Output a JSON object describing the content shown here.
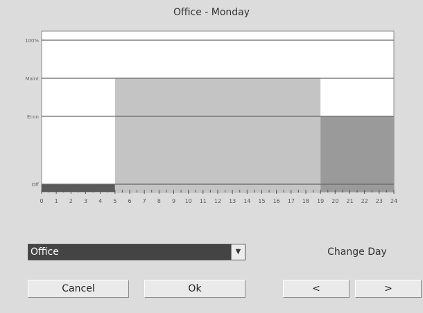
{
  "window": {
    "title": "Office - Monday"
  },
  "chart_data": {
    "type": "area",
    "title": "Office - Monday",
    "y_tick_labels": [
      "100%",
      "Maint",
      "Econ",
      "Off"
    ],
    "x": [
      0,
      1,
      2,
      3,
      4,
      5,
      6,
      7,
      8,
      9,
      10,
      11,
      12,
      13,
      14,
      15,
      16,
      17,
      18,
      19,
      20,
      21,
      22,
      23,
      24
    ],
    "x_tick_labels": [
      "0",
      "1",
      "2",
      "3",
      "4",
      "5",
      "6",
      "7",
      "8",
      "9",
      "10",
      "11",
      "12",
      "13",
      "14",
      "15",
      "16",
      "17",
      "18",
      "19",
      "20",
      "21",
      "22",
      "23",
      "24"
    ],
    "xlim": [
      0,
      24
    ],
    "segments": [
      {
        "start": 0,
        "end": 5,
        "level": "Off"
      },
      {
        "start": 5,
        "end": 19,
        "level": "Maint"
      },
      {
        "start": 19,
        "end": 24,
        "level": "Econ"
      }
    ],
    "grid": true,
    "colors": {
      "Off": "#5a5a5a",
      "Maint": "#c4c4c4",
      "Econ": "#9a9a9a",
      "background": "#ffffff"
    }
  },
  "controls": {
    "profile_select": {
      "value": "Office"
    },
    "change_day_label": "Change Day",
    "cancel_label": "Cancel",
    "ok_label": "Ok",
    "prev_label": "<",
    "next_label": ">"
  },
  "icons": {
    "dropdown_arrow": "chevron-down-icon"
  }
}
